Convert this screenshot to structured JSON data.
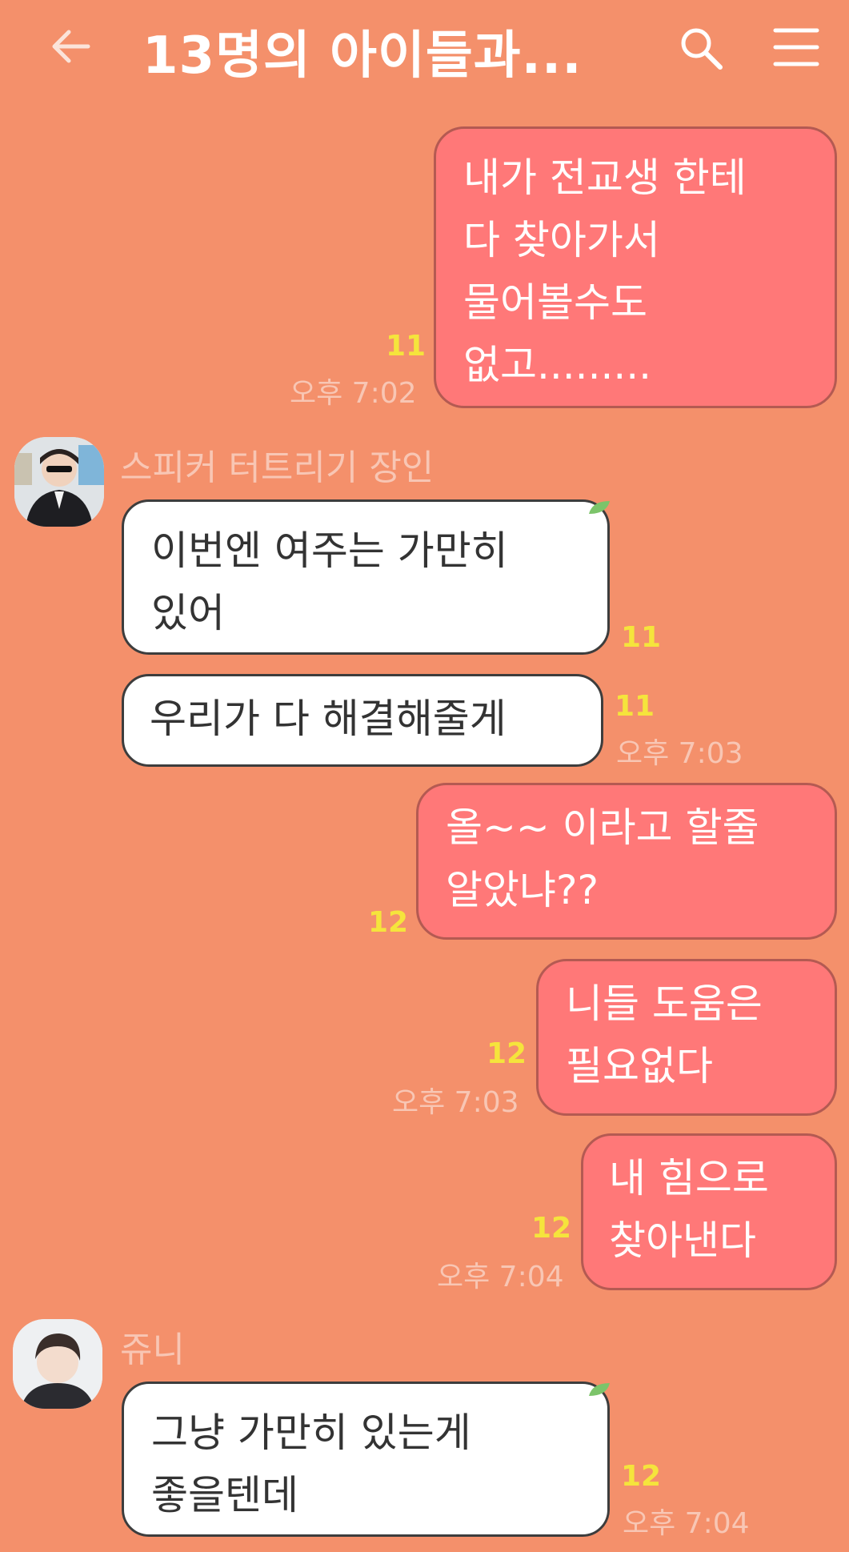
{
  "header": {
    "title": "13명의 아이들과...",
    "back_icon": "arrow-left-icon",
    "search_icon": "search-icon",
    "menu_icon": "hamburger-menu-icon"
  },
  "colors": {
    "background": "#F4906B",
    "my_bubble": "#FF7878",
    "their_bubble": "#FFFFFF",
    "unread_count": "#F5E43C",
    "timestamp": "#F8C6B4"
  },
  "messages": [
    {
      "from": "me",
      "text": "내가 전교생 한테\n다 찾아가서\n물어볼수도\n없고.........",
      "unread": "11",
      "time": "오후 7:02"
    },
    {
      "from": "them",
      "sender": "스피커 터트리기 장인",
      "text": "이번엔 여주는 가만히\n있어",
      "unread": "11"
    },
    {
      "from": "them",
      "text": "우리가 다 해결해줄게",
      "unread": "11",
      "time": "오후 7:03"
    },
    {
      "from": "me",
      "text": "올~~ 이라고 할줄\n알았냐??",
      "unread": "12"
    },
    {
      "from": "me",
      "text": "니들 도움은\n필요없다",
      "unread": "12",
      "time": "오후 7:03"
    },
    {
      "from": "me",
      "text": "내 힘으로\n찾아낸다",
      "unread": "12",
      "time": "오후 7:04"
    },
    {
      "from": "them",
      "sender": "쥬니",
      "text": "그냥 가만히 있는게\n좋을텐데",
      "unread": "12",
      "time": "오후 7:04"
    }
  ]
}
